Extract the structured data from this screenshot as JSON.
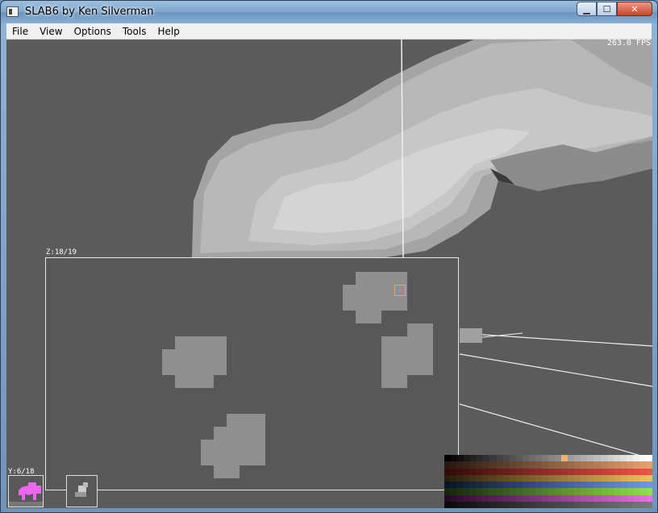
{
  "window": {
    "title": "SLAB6 by Ken Silverman",
    "caption_buttons": [
      {
        "name": "minimize",
        "glyph": "▁"
      },
      {
        "name": "maximize",
        "glyph": "☐"
      },
      {
        "name": "close",
        "glyph": "✕"
      }
    ]
  },
  "menu": {
    "items": [
      "File",
      "View",
      "Options",
      "Tools",
      "Help"
    ]
  },
  "viewport": {
    "fps_text": "263.0 FPS",
    "background_color": "#5b5b5b"
  },
  "slice_z": {
    "label": "Z:18/19"
  },
  "slice_y": {
    "label": "Y:6/18"
  },
  "cursor_color": "#e8a45c",
  "voxel_shape_color": "#8f8f8f",
  "palette": {
    "selected_color": "#f0b070"
  }
}
